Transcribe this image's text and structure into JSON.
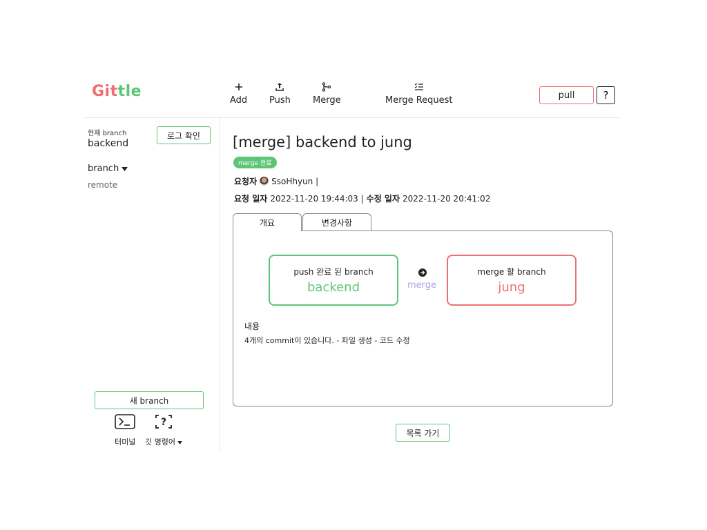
{
  "app": {
    "logo_part1": "Git",
    "logo_part2": "tle"
  },
  "toolbar": {
    "items": [
      {
        "label": "Add",
        "icon": "plus-icon"
      },
      {
        "label": "Push",
        "icon": "upload-icon"
      },
      {
        "label": "Merge",
        "icon": "git-merge-icon"
      },
      {
        "label": "Merge Request",
        "icon": "checklist-icon"
      }
    ],
    "pull_label": "pull",
    "help_label": "?"
  },
  "sidebar": {
    "current_branch_label": "현재 branch",
    "current_branch": "backend",
    "log_button": "로그 확인",
    "branch_dropdown": "branch",
    "remote": "remote",
    "new_branch_button": "새 branch",
    "terminal_label": "터미널",
    "git_commands_label": "깃 명령어"
  },
  "merge_request": {
    "title": "[merge] backend to jung",
    "status": "merge 완료",
    "requester_label": "요청자",
    "requester": "SsoHhyun |",
    "request_date_label": "요청 일자",
    "request_date": "2022-11-20 19:44:03 |",
    "modified_date_label": "수정 일자",
    "modified_date": "2022-11-20 20:41:02",
    "tabs": [
      {
        "label": "개요",
        "active": true
      },
      {
        "label": "변경사항",
        "active": false
      }
    ],
    "source": {
      "caption": "push 완료 된 branch",
      "name": "backend"
    },
    "target": {
      "caption": "merge 할 branch",
      "name": "jung"
    },
    "merge_word": "merge",
    "content_label": "내용",
    "content": "4개의 commit이 있습니다. - 파일 생성 - 코드 수정",
    "list_button": "목록 가기"
  },
  "colors": {
    "accent_green": "#5cc676",
    "accent_red": "#ef6f6f",
    "merge_purple": "#b49ce8"
  }
}
